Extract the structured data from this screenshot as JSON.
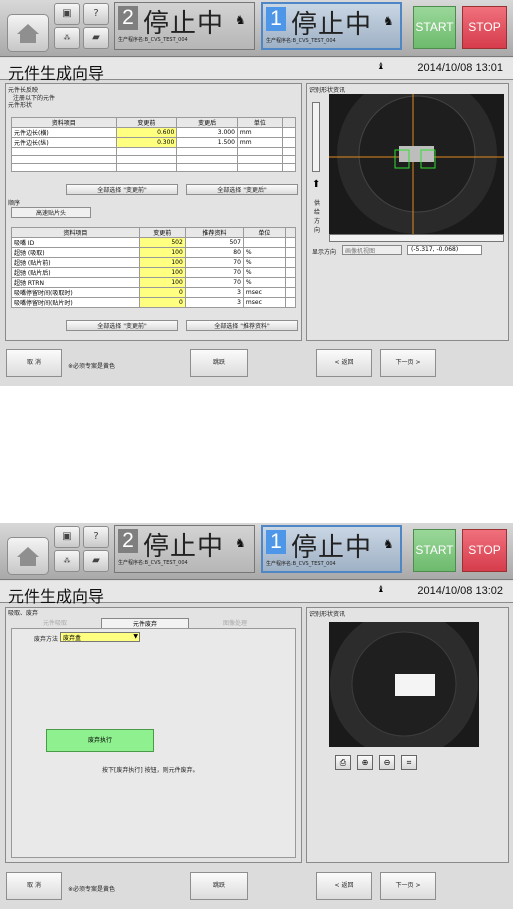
{
  "header": {
    "station_right": {
      "num": "2",
      "status": "停止中",
      "program": "生产程序名:B_CVS_TEST_004"
    },
    "station_left": {
      "num": "1",
      "status": "停止中",
      "program": "生产程序名:B_CVS_TEST_004"
    },
    "start_label": "START",
    "stop_label": "STOP"
  },
  "screen1": {
    "title": "元件生成向导",
    "datetime": "2014/10/08 13:01",
    "reverse_title": "元件长反映",
    "reverse_note": "注册以下的元件",
    "shape_title": "元件形状",
    "shape_cols": [
      "资料项目",
      "变更前",
      "变更后",
      "单位"
    ],
    "shape_rows": [
      [
        "元件边长(横)",
        "0.600",
        "3.000",
        "mm"
      ],
      [
        "元件边长(纵)",
        "0.300",
        "1.500",
        "mm"
      ]
    ],
    "btn_all_before": "全部选择 \"变更前\"",
    "btn_all_after": "全部选择 \"变更后\"",
    "seq_title": "顺序",
    "seq_head": "高速贴片头",
    "seq_cols": [
      "资料项目",
      "变更前",
      "推荐资料",
      "单位"
    ],
    "seq_rows": [
      [
        "吸嘴 ID",
        "502",
        "507",
        ""
      ],
      [
        "超驰 (吸取)",
        "100",
        "80",
        "%"
      ],
      [
        "超驰 (贴片前)",
        "100",
        "70",
        "%"
      ],
      [
        "超驰 (贴片后)",
        "100",
        "70",
        "%"
      ],
      [
        "超驰 RTRN",
        "100",
        "70",
        "%"
      ],
      [
        "吸嘴停留时间(吸取时)",
        "0",
        "3",
        "msec"
      ],
      [
        "吸嘴停留时间(贴片时)",
        "0",
        "3",
        "msec"
      ]
    ],
    "btn_seq_before": "全部选择 \"变更前\"",
    "btn_seq_rec": "全部选择 \"推荐资料\"",
    "recog_title": "识别形状资讯",
    "feed_label": "供给方向",
    "display_dir": "显示方向",
    "display_sel": "画像机视图",
    "coord": "(-5.317, -0.068)",
    "cancel": "取 消",
    "required_note": "※必须专案是黄色",
    "skip": "跳跃",
    "back": "< 返回",
    "next": "下一页 >"
  },
  "screen2": {
    "title": "元件生成向导",
    "datetime": "2014/10/08 13:02",
    "section": "吸取、废弃",
    "tabs": [
      "元件吸取",
      "元件废弃",
      "图像处理"
    ],
    "discard_method_label": "废弃方法",
    "discard_method_value": "废弃盒",
    "discard_exec": "废弃执行",
    "discard_hint": "按下[废弃执行] 按钮，则元件废弃。",
    "recog_title": "识别形状资讯",
    "cancel": "取 消",
    "required_note": "※必须专案是黄色",
    "skip": "跳跃",
    "back": "< 返回",
    "next": "下一页 >"
  }
}
